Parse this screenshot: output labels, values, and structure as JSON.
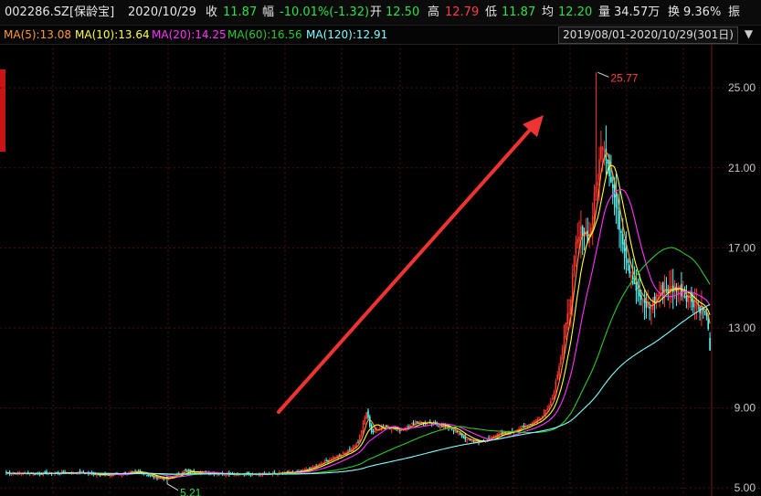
{
  "header": {
    "code": "002286.SZ",
    "name": "[保龄宝]",
    "date": "2020/10/29",
    "close_label": "收",
    "close": "11.87",
    "change_label": "幅",
    "change": "-10.01%(-1.32)",
    "open_label": "开",
    "open": "12.50",
    "high_label": "高",
    "high": "12.79",
    "low_label": "低",
    "low": "11.87",
    "avg_label": "均",
    "avg": "12.20",
    "volume_label": "量",
    "volume": "34.57万",
    "turnover_label": "换",
    "turnover": "9.36%",
    "amplitude_label": "振"
  },
  "ma_bar": {
    "ma5": "MA(5):13.08",
    "ma10": "MA(10):13.64",
    "ma20": "MA(20):14.25",
    "ma60": "MA(60):16.56",
    "ma120": "MA(120):12.91",
    "range": "2019/08/01-2020/10/29(301日)",
    "range_icon": "chevron-down-icon"
  },
  "colors": {
    "background": "#000000",
    "up": "#ff3232",
    "down": "#54fcfc",
    "ma5": "#ff9a2e",
    "ma10": "#ffff3c",
    "ma20": "#ff33ff",
    "ma60": "#2ec72e",
    "ma120": "#7fffff",
    "arrow": "#ee3333",
    "grid": "#4a1010",
    "header_value_green": "#2ee04a",
    "header_value_red": "#ff4040"
  },
  "chart_data": {
    "type": "candlestick",
    "period": "2019/08/01-2020/10/29",
    "ylim": [
      4.6,
      27.2
    ],
    "y_ticks": [
      "25.00",
      "21.00",
      "17.00",
      "13.00",
      "9.00",
      "5.00"
    ],
    "annotations": [
      {
        "label": "25.77",
        "value": 25.77,
        "kind": "high"
      },
      {
        "label": "5.21",
        "value": 5.21,
        "kind": "low"
      }
    ],
    "trend_arrow": {
      "direction": "up",
      "color": "#ee3333"
    },
    "close_anchors": [
      [
        0,
        5.75
      ],
      [
        20,
        5.72
      ],
      [
        40,
        5.78
      ],
      [
        60,
        5.65
      ],
      [
        80,
        5.8
      ],
      [
        88,
        5.55
      ],
      [
        96,
        5.45
      ],
      [
        106,
        5.85
      ],
      [
        120,
        5.75
      ],
      [
        140,
        5.68
      ],
      [
        160,
        5.72
      ],
      [
        175,
        5.8
      ],
      [
        185,
        6.1
      ],
      [
        195,
        6.5
      ],
      [
        205,
        6.9
      ],
      [
        210,
        7.3
      ],
      [
        215,
        8.8
      ],
      [
        218,
        7.8
      ],
      [
        225,
        8.1
      ],
      [
        235,
        7.9
      ],
      [
        245,
        8.3
      ],
      [
        255,
        8.2
      ],
      [
        265,
        8.0
      ],
      [
        275,
        7.4
      ],
      [
        285,
        7.3
      ],
      [
        290,
        7.6
      ],
      [
        300,
        7.8
      ],
      [
        310,
        8.1
      ],
      [
        320,
        8.6
      ],
      [
        326,
        9.5
      ],
      [
        332,
        12.0
      ],
      [
        336,
        14.0
      ],
      [
        340,
        17.0
      ],
      [
        344,
        18.0
      ],
      [
        348,
        17.5
      ],
      [
        352,
        20.0
      ],
      [
        356,
        22.5
      ],
      [
        360,
        21.0
      ],
      [
        364,
        19.0
      ],
      [
        368,
        17.5
      ],
      [
        372,
        16.0
      ],
      [
        376,
        15.0
      ],
      [
        380,
        14.2
      ],
      [
        384,
        14.0
      ],
      [
        388,
        14.6
      ],
      [
        392,
        15.0
      ],
      [
        396,
        14.9
      ],
      [
        400,
        15.1
      ],
      [
        404,
        14.8
      ],
      [
        408,
        14.5
      ],
      [
        412,
        14.2
      ],
      [
        416,
        13.9
      ],
      [
        419,
        13.2
      ],
      [
        420,
        11.87
      ]
    ],
    "ma_series": [
      {
        "name": "MA(5)",
        "period": 5,
        "last": 13.08
      },
      {
        "name": "MA(10)",
        "period": 10,
        "last": 13.64
      },
      {
        "name": "MA(20)",
        "period": 20,
        "last": 14.25
      },
      {
        "name": "MA(60)",
        "period": 60,
        "last": 16.56
      },
      {
        "name": "MA(120)",
        "period": 120,
        "last": 12.91
      }
    ]
  }
}
